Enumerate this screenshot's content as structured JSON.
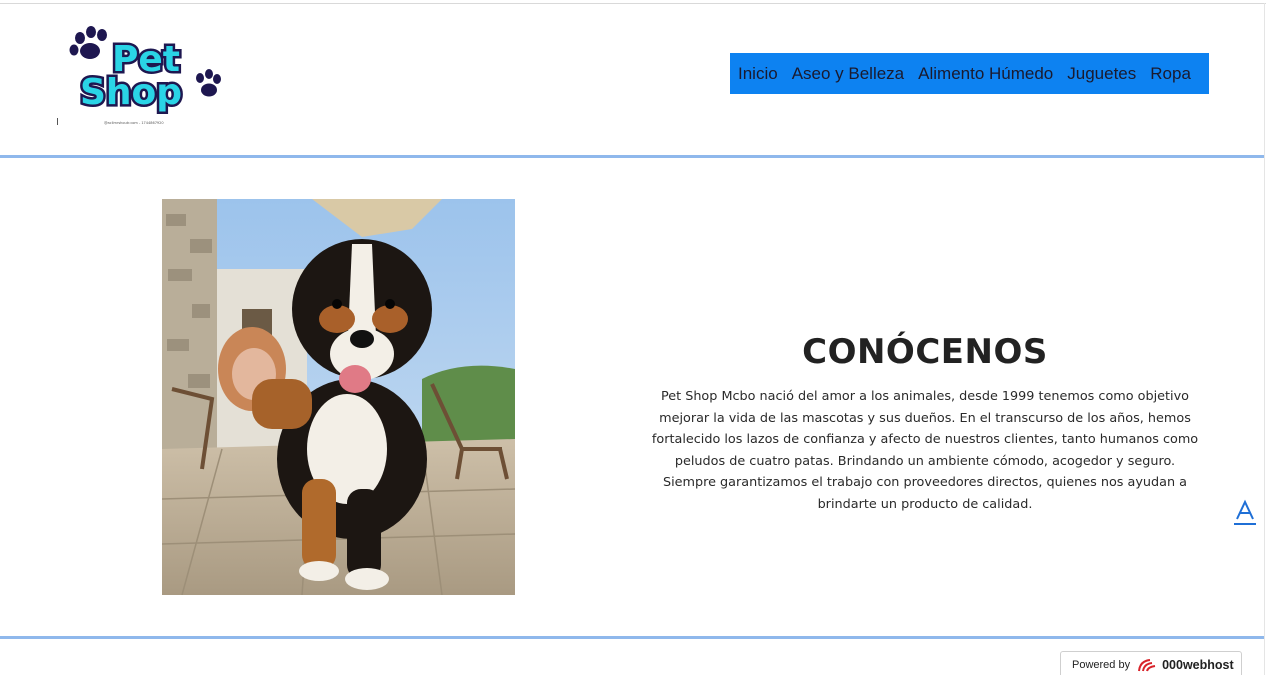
{
  "header": {
    "logo_text_line1": "Pet",
    "logo_text_line2": "Shop",
    "logo_caption": "@acllmrshoutr.com - 1744867920"
  },
  "nav": {
    "items": [
      {
        "label": "Inicio"
      },
      {
        "label": "Aseo y Belleza"
      },
      {
        "label": "Alimento Húmedo"
      },
      {
        "label": "Juguetes"
      },
      {
        "label": "Ropa"
      }
    ]
  },
  "about": {
    "title": "CONÓCENOS",
    "body": "Pet Shop Mcbo nació del amor a los animales, desde 1999 tenemos como objetivo mejorar la vida de las mascotas y sus dueños. En el transcurso de los años, hemos fortalecido los lazos de confianza y afecto de nuestros clientes, tanto humanos como peludos de cuatro patas. Brindando un ambiente cómodo, acogedor y seguro. Siempre garantizamos el trabajo con proveedores directos, quienes nos ayudan a brindarte un producto de calidad."
  },
  "scroll_top": {
    "glyph": "A",
    "icon": "arrow-up-icon"
  },
  "footer": {
    "powered_by": "Powered by",
    "brand": "000webhost"
  },
  "colors": {
    "nav_bg": "#0d82f1",
    "logo_fill": "#2ad4e6",
    "logo_dark": "#1e1750",
    "divider": "#8fb8ec",
    "brand_red": "#d8232a"
  }
}
